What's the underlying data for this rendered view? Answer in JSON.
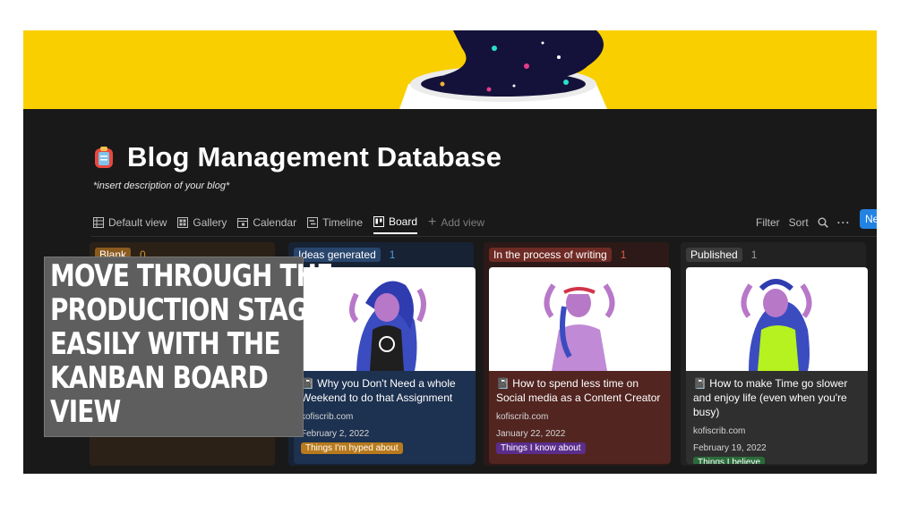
{
  "page": {
    "title": "Blog Management Database",
    "description": "*insert description of your blog*"
  },
  "views": [
    {
      "label": "Default view",
      "icon": "table-icon"
    },
    {
      "label": "Gallery",
      "icon": "gallery-icon"
    },
    {
      "label": "Calendar",
      "icon": "calendar-icon"
    },
    {
      "label": "Timeline",
      "icon": "timeline-icon"
    },
    {
      "label": "Board",
      "icon": "board-icon",
      "active": true
    },
    {
      "label": "Add view",
      "icon": "plus-icon"
    }
  ],
  "toolbar": {
    "filter": "Filter",
    "sort": "Sort",
    "search_icon": "search-icon",
    "more_icon": "more-icon",
    "new_label": "Ne"
  },
  "columns": [
    {
      "name": "Blank",
      "count": "0",
      "tag_color": "#8a5a1e",
      "count_color": "#d1902a"
    },
    {
      "name": "Ideas generated",
      "count": "1",
      "tag_color": "#28456c",
      "count_color": "#4a9ae6",
      "card": {
        "title": "Why you Don't Need a whole Weekend to do that Assignment",
        "site": "kofiscrib.com",
        "date": "February 2, 2022",
        "tag": "Things I'm hyped about",
        "tag_color": "#b87a1c"
      }
    },
    {
      "name": "In the process of writing",
      "count": "1",
      "tag_color": "#6e2a24",
      "count_color": "#e05a4a",
      "card": {
        "title": "How to spend less time on Social media as a Content Creator",
        "site": "kofiscrib.com",
        "date": "January 22, 2022",
        "tag": "Things I know about",
        "tag_color": "#5b2d8c"
      }
    },
    {
      "name": "Published",
      "count": "1",
      "tag_color": "#3b3b3b",
      "count_color": "#9b9b9b",
      "card": {
        "title": "How to make Time go slower and enjoy life (even when you're busy)",
        "site": "kofiscrib.com",
        "date": "February 19, 2022",
        "tag": "Things I believe",
        "tag_color": "#2b6b3a"
      }
    }
  ],
  "overlay": {
    "lines": [
      "Move through the",
      "production stages",
      "easily with the",
      "kanban board",
      "view"
    ]
  },
  "colors": {
    "cover": "#f9cf00",
    "background": "#191919",
    "accent": "#2383e2"
  }
}
